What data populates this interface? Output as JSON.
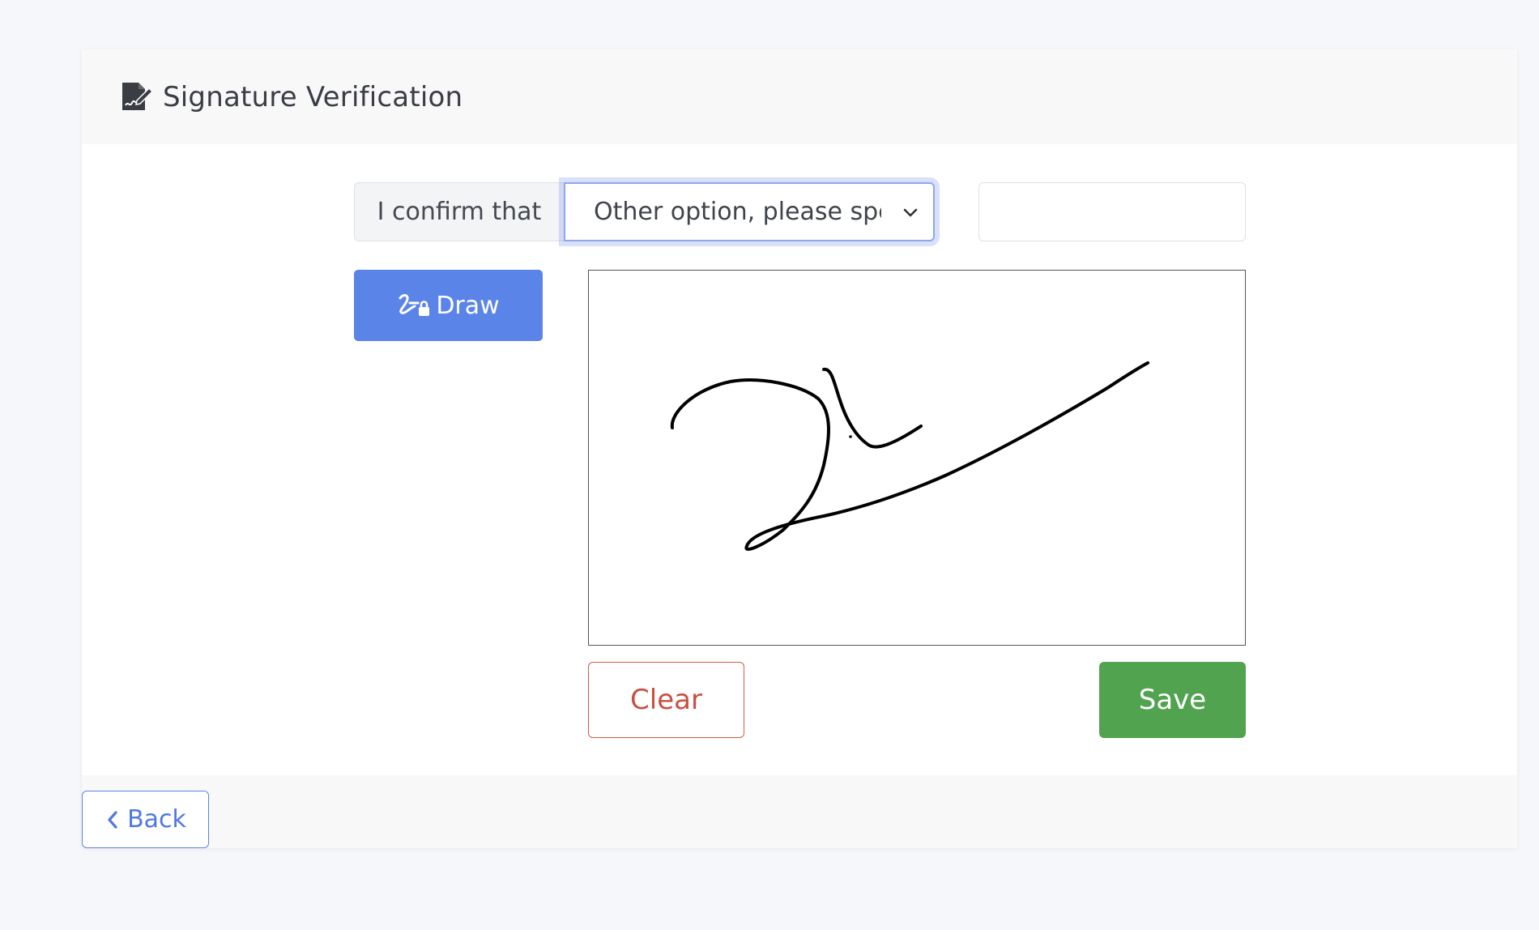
{
  "header": {
    "icon": "signature-icon",
    "title": "Signature Verification"
  },
  "confirm": {
    "label": "I confirm that",
    "selected_option": "Other option, please specify",
    "other_value": ""
  },
  "draw_button": {
    "icon": "signature-lock-icon",
    "label": "Draw"
  },
  "actions": {
    "clear_label": "Clear",
    "save_label": "Save"
  },
  "footer": {
    "back_label": "Back",
    "back_icon": "chevron-left-icon"
  },
  "colors": {
    "primary": "#5a84e8",
    "danger": "#c94f41",
    "success": "#52a350"
  }
}
